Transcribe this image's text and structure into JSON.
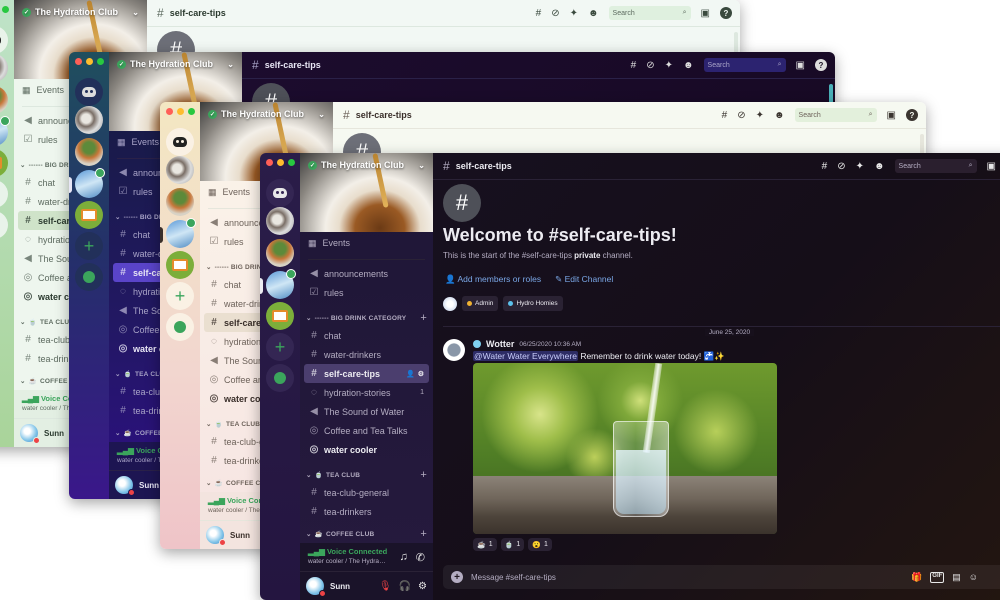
{
  "server": {
    "name": "The Hydration Club"
  },
  "channel": {
    "name": "self-care-tips"
  },
  "header": {
    "search_placeholder": "Search"
  },
  "sidebar": {
    "events": "Events",
    "top_channels": [
      {
        "name": "announcements",
        "icon": "megaphone-icon"
      },
      {
        "name": "rules",
        "icon": "checkbox-icon"
      }
    ],
    "categories": [
      {
        "name": "------ BIG DRINK CATEGORY",
        "channels": [
          {
            "name": "chat",
            "type": "text"
          },
          {
            "name": "water-drinkers",
            "type": "text"
          },
          {
            "name": "self-care-tips",
            "type": "text",
            "selected": true
          },
          {
            "name": "hydration-stories",
            "type": "forum",
            "unread": "1"
          },
          {
            "name": "The Sound of Water",
            "type": "voice"
          },
          {
            "name": "Coffee and Tea Talks",
            "type": "stage"
          },
          {
            "name": "water cooler",
            "type": "stage",
            "bold": true
          }
        ]
      },
      {
        "name": "TEA CLUB",
        "emoji": "🍵",
        "channels": [
          {
            "name": "tea-club-general",
            "type": "text"
          },
          {
            "name": "tea-drinkers",
            "type": "text"
          }
        ]
      },
      {
        "name": "COFFEE CLUB",
        "emoji": "☕",
        "channels": []
      }
    ]
  },
  "voice": {
    "status": "Voice Connected",
    "location": "water cooler / The Hydration Club"
  },
  "user": {
    "name": "Sunn"
  },
  "welcome": {
    "title": "Welcome to #self-care-tips!",
    "subtitle_prefix": "This is the start of the #self-care-tips ",
    "subtitle_bold": "private",
    "subtitle_suffix": " channel.",
    "add_members": "Add members or roles",
    "edit_channel": "Edit Channel",
    "roles": [
      {
        "name": "Admin",
        "color": "#f0b232"
      },
      {
        "name": "Hydro Homies",
        "color": "#5bc0eb"
      }
    ]
  },
  "divider_date": "June 25, 2020",
  "message": {
    "author": "Wotter",
    "timestamp": "06/25/2020 10:36 AM",
    "mention": "@Water Water Everywhere",
    "text": " Remember to drink water today! ",
    "emojis": "🚰✨",
    "reactions": [
      {
        "emoji": "☕",
        "count": "1"
      },
      {
        "emoji": "🍵",
        "count": "1"
      },
      {
        "emoji": "😮",
        "count": "1"
      }
    ]
  },
  "composer": {
    "placeholder": "Message #self-care-tips"
  }
}
